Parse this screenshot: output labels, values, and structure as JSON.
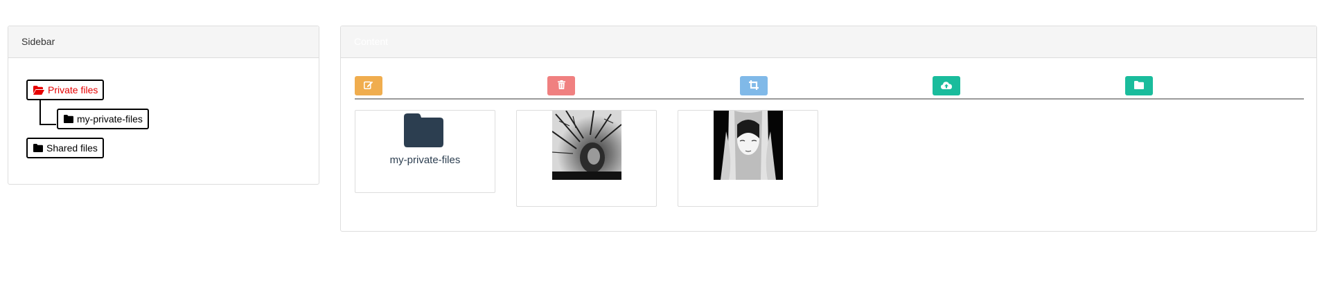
{
  "sidebar": {
    "title": "Sidebar",
    "tree": [
      {
        "label": "Private files",
        "icon": "folder-open-icon",
        "state": "open-selected"
      },
      {
        "label": "my-private-files",
        "icon": "folder-icon",
        "state": "child"
      },
      {
        "label": "Shared files",
        "icon": "folder-icon",
        "state": "closed"
      }
    ]
  },
  "content": {
    "title": "Content",
    "toolbar": [
      {
        "icon": "edit-icon",
        "color": "#f0ad4e"
      },
      {
        "icon": "trash-icon",
        "color": "#f08080"
      },
      {
        "icon": "crop-icon",
        "color": "#80b9e8"
      },
      {
        "icon": "cloud-upload-icon",
        "color": "#1abc9c"
      },
      {
        "icon": "folder-icon",
        "color": "#1abc9c"
      }
    ],
    "items": [
      {
        "type": "folder",
        "label": "my-private-files"
      },
      {
        "type": "image",
        "label": ""
      },
      {
        "type": "image",
        "label": ""
      }
    ]
  },
  "colors": {
    "active_node": "#e60000",
    "folder_tile": "#2c3e50",
    "panel_heading_bg": "#f5f5f5",
    "border": "#dddddd"
  }
}
